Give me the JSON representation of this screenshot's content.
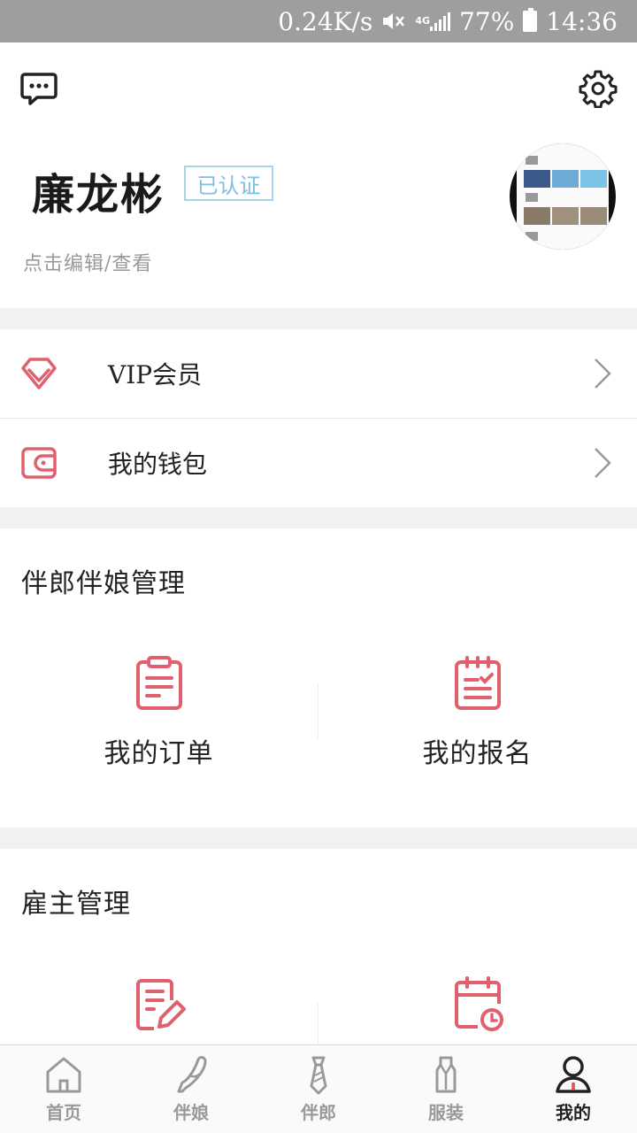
{
  "status_bar": {
    "speed": "0.24K/s",
    "network": "4G",
    "battery": "77%",
    "time": "14:36"
  },
  "header": {
    "left_icon": "message-icon",
    "right_icon": "gear-icon"
  },
  "profile": {
    "name": "廉龙彬",
    "badge": "已认证",
    "edit_hint": "点击编辑/查看"
  },
  "menu": [
    {
      "icon": "diamond-icon",
      "label": "VIP会员"
    },
    {
      "icon": "wallet-icon",
      "label": "我的钱包"
    }
  ],
  "sections": [
    {
      "title": "伴郎伴娘管理",
      "items": [
        {
          "icon": "clipboard-icon",
          "label": "我的订单"
        },
        {
          "icon": "clipboard-check-icon",
          "label": "我的报名"
        }
      ]
    },
    {
      "title": "雇主管理",
      "items": [
        {
          "icon": "edit-document-icon"
        },
        {
          "icon": "calendar-clock-icon"
        }
      ]
    }
  ],
  "tabs": [
    {
      "icon": "home-icon",
      "label": "首页"
    },
    {
      "icon": "high-heel-icon",
      "label": "伴娘"
    },
    {
      "icon": "tie-icon",
      "label": "伴郎"
    },
    {
      "icon": "suit-icon",
      "label": "服装"
    },
    {
      "icon": "user-icon",
      "label": "我的",
      "active": true
    }
  ],
  "colors": {
    "accent": "#e0606e",
    "badge": "#7fbfe0",
    "separator": "#f1f1f1",
    "status_bar": "#9e9e9e"
  }
}
